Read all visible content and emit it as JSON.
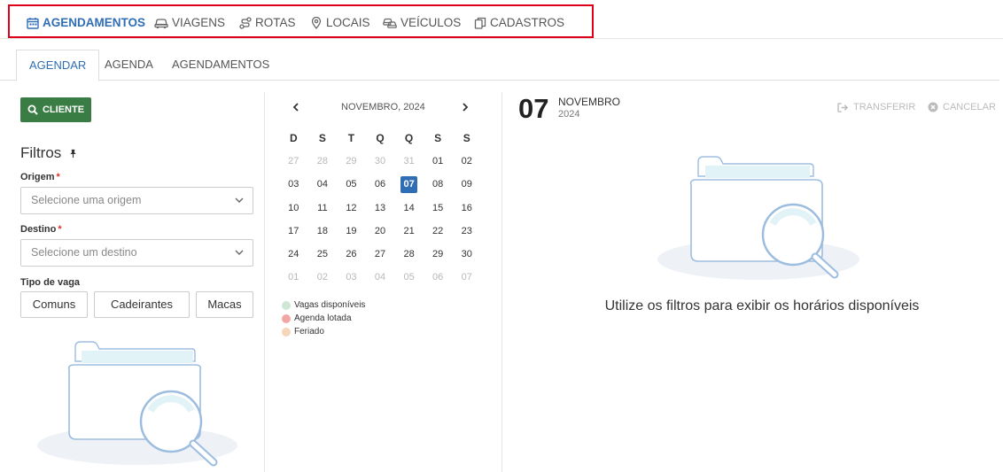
{
  "topnav": {
    "items": [
      {
        "label": "AGENDAMENTOS",
        "icon": "calendar-icon",
        "active": true
      },
      {
        "label": "VIAGENS",
        "icon": "bus-icon"
      },
      {
        "label": "ROTAS",
        "icon": "route-icon"
      },
      {
        "label": "LOCAIS",
        "icon": "map-pin-icon"
      },
      {
        "label": "VEÍCULOS",
        "icon": "vehicles-icon"
      },
      {
        "label": "CADASTROS",
        "icon": "copy-icon"
      }
    ]
  },
  "subtabs": [
    "AGENDAR",
    "AGENDA",
    "AGENDAMENTOS"
  ],
  "left": {
    "cliente_button": "CLIENTE",
    "filtros_title": "Filtros",
    "origem_label": "Origem",
    "origem_placeholder": "Selecione uma origem",
    "destino_label": "Destino",
    "destino_placeholder": "Selecione um destino",
    "required_mark": "*",
    "tipo_vaga_label": "Tipo de vaga",
    "tipo_vaga_options": [
      "Comuns",
      "Cadeirantes",
      "Macas"
    ]
  },
  "calendar": {
    "header": "NOVEMBRO, 2024",
    "weekdays": [
      "D",
      "S",
      "T",
      "Q",
      "Q",
      "S",
      "S"
    ],
    "weeks": [
      [
        "27",
        "28",
        "29",
        "30",
        "31",
        "01",
        "02"
      ],
      [
        "03",
        "04",
        "05",
        "06",
        "07",
        "08",
        "09"
      ],
      [
        "10",
        "11",
        "12",
        "13",
        "14",
        "15",
        "16"
      ],
      [
        "17",
        "18",
        "19",
        "20",
        "21",
        "22",
        "23"
      ],
      [
        "24",
        "25",
        "26",
        "27",
        "28",
        "29",
        "30"
      ],
      [
        "01",
        "02",
        "03",
        "04",
        "05",
        "06",
        "07"
      ]
    ],
    "selected": "07",
    "legend": [
      {
        "label": "Vagas disponíveis",
        "color": "#cfe8d4"
      },
      {
        "label": "Agenda lotada",
        "color": "#f2a7a7"
      },
      {
        "label": "Feriado",
        "color": "#f6d6b8"
      }
    ]
  },
  "right": {
    "day": "07",
    "month": "NOVEMBRO",
    "year": "2024",
    "transferir": "TRANSFERIR",
    "cancelar": "CANCELAR",
    "empty_message": "Utilize os filtros para exibir os horários disponíveis"
  },
  "colors": {
    "accent": "#2f6eb5",
    "success": "#3a7d44",
    "highlight_box": "#e0001a"
  }
}
